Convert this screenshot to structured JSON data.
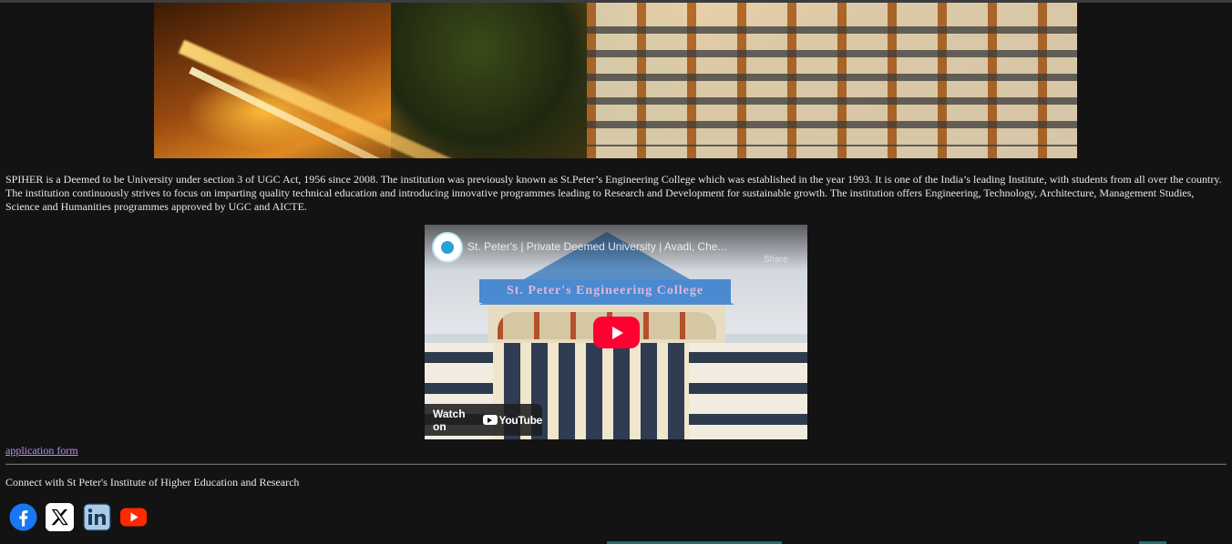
{
  "hero": {
    "alt": "St. Peter's campus at night"
  },
  "description": "SPIHER is a Deemed to be University under section 3 of UGC Act, 1956 since 2008. The institution was previously known as St.Peter’s Engineering College which was established in the year 1993. It is one of the India’s leading Institute, with students from all over the country. The institution continuously strives to focus on imparting quality technical education and introducing innovative programmes leading to Research and Development for sustainable growth. The institution offers Engineering, Technology, Architecture, Management Studies, Science and Humanities programmes approved by UGC and AICTE.",
  "video": {
    "title": "St. Peter's | Private Deemed University | Avadi, Che...",
    "share_label": "Share",
    "banner_text": "St. Peter's Engineering College",
    "watch_on": "Watch on",
    "youtube": "YouTube"
  },
  "links": {
    "application_form": "application form"
  },
  "footer": {
    "connect_text": "Connect with St Peter's Institute of Higher Education and Research"
  },
  "social": [
    {
      "name": "facebook",
      "icon": "facebook-icon",
      "color": "#1877f2"
    },
    {
      "name": "x",
      "icon": "x-icon",
      "color": "#000000"
    },
    {
      "name": "linkedin",
      "icon": "linkedin-icon",
      "color": "#0a66c2"
    },
    {
      "name": "youtube",
      "icon": "youtube-icon",
      "color": "#ff0000"
    }
  ],
  "colors": {
    "background": "#131313",
    "text": "#e8e8e8",
    "link": "#b694ea"
  }
}
